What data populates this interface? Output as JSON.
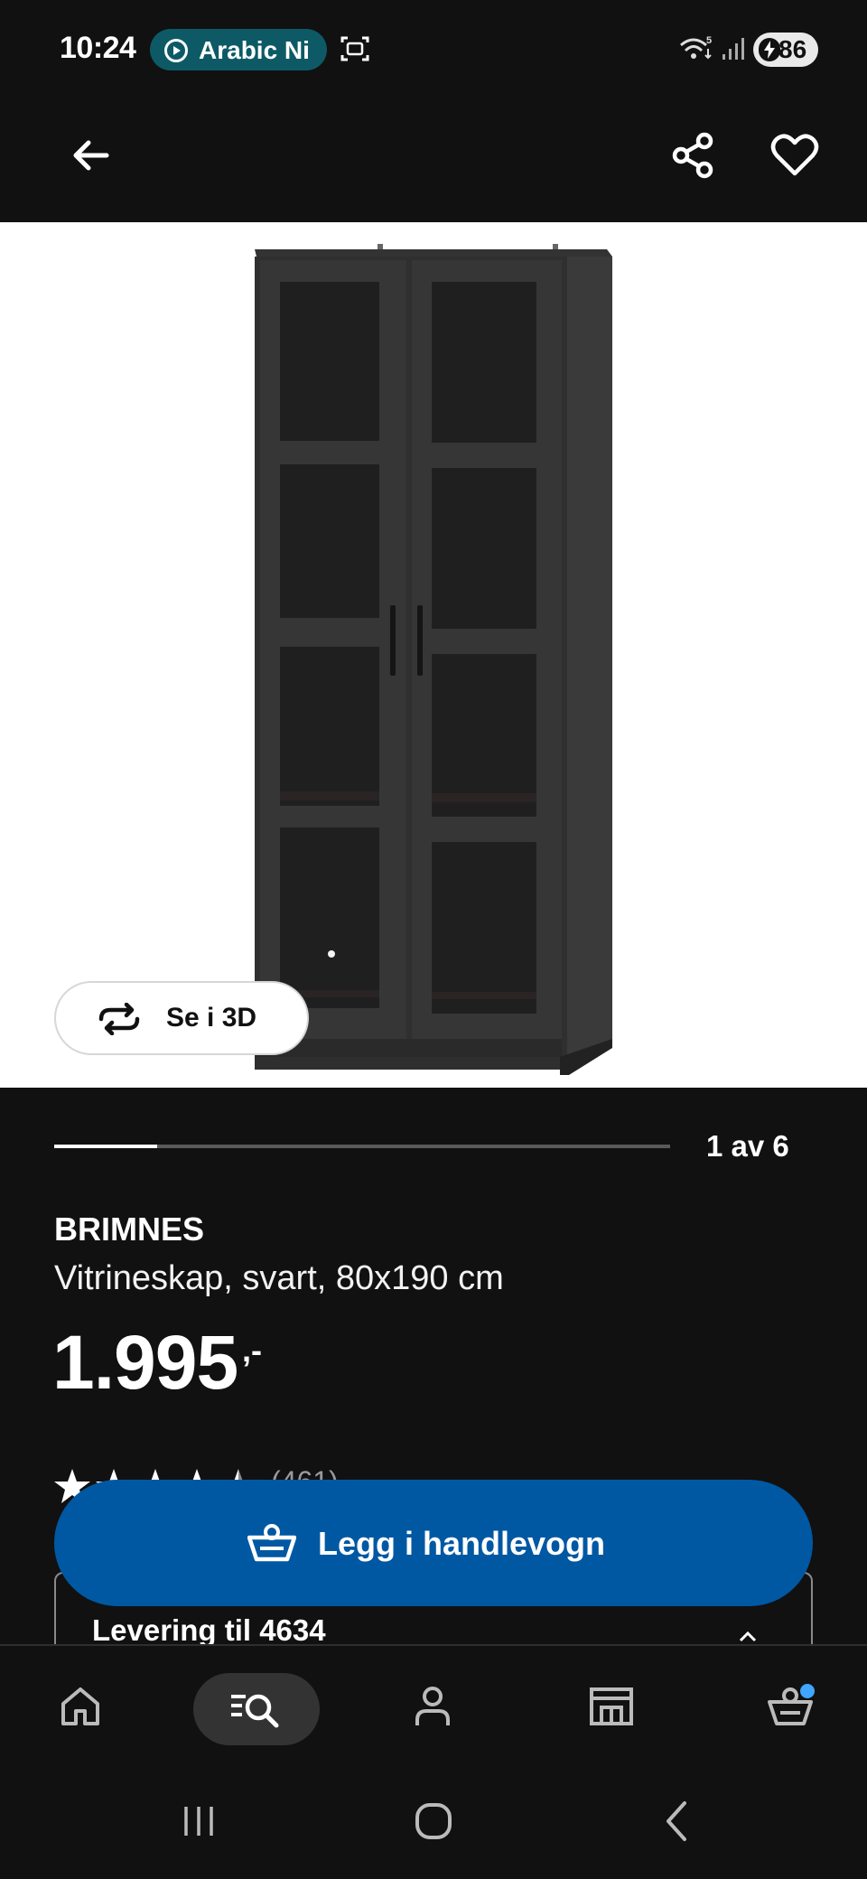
{
  "status_bar": {
    "time": "10:24",
    "media_label": "Arabic Ni",
    "battery_level": "86",
    "signal_badge": "5"
  },
  "app_bar": {
    "back_icon": "arrow-left-icon",
    "share_icon": "share-icon",
    "favorite_icon": "heart-icon"
  },
  "gallery": {
    "view_3d_label": "Se i 3D",
    "page_indicator": "1 av 6",
    "current_index": 1,
    "total": 6
  },
  "product": {
    "brand": "BRIMNES",
    "description": "Vitrineskap, svart, 80x190 cm",
    "price": "1.995",
    "price_suffix": ",-",
    "rating": 4.5,
    "rating_count": "(461)"
  },
  "cart_button": {
    "label": "Legg i handlevogn",
    "icon": "basket-icon",
    "color": "#0058a3"
  },
  "delivery": {
    "label": "Levering til 4634"
  },
  "bottom_nav": {
    "items": [
      {
        "name": "home",
        "icon": "home-icon"
      },
      {
        "name": "search",
        "icon": "search-icon",
        "active": true
      },
      {
        "name": "profile",
        "icon": "person-icon"
      },
      {
        "name": "store",
        "icon": "store-icon"
      },
      {
        "name": "cart",
        "icon": "basket-icon",
        "badge_color": "#3fa5ff"
      }
    ]
  },
  "system_nav": {
    "recents_icon": "recents-icon",
    "home_icon": "home-circle-icon",
    "back_icon": "back-chevron-icon"
  }
}
